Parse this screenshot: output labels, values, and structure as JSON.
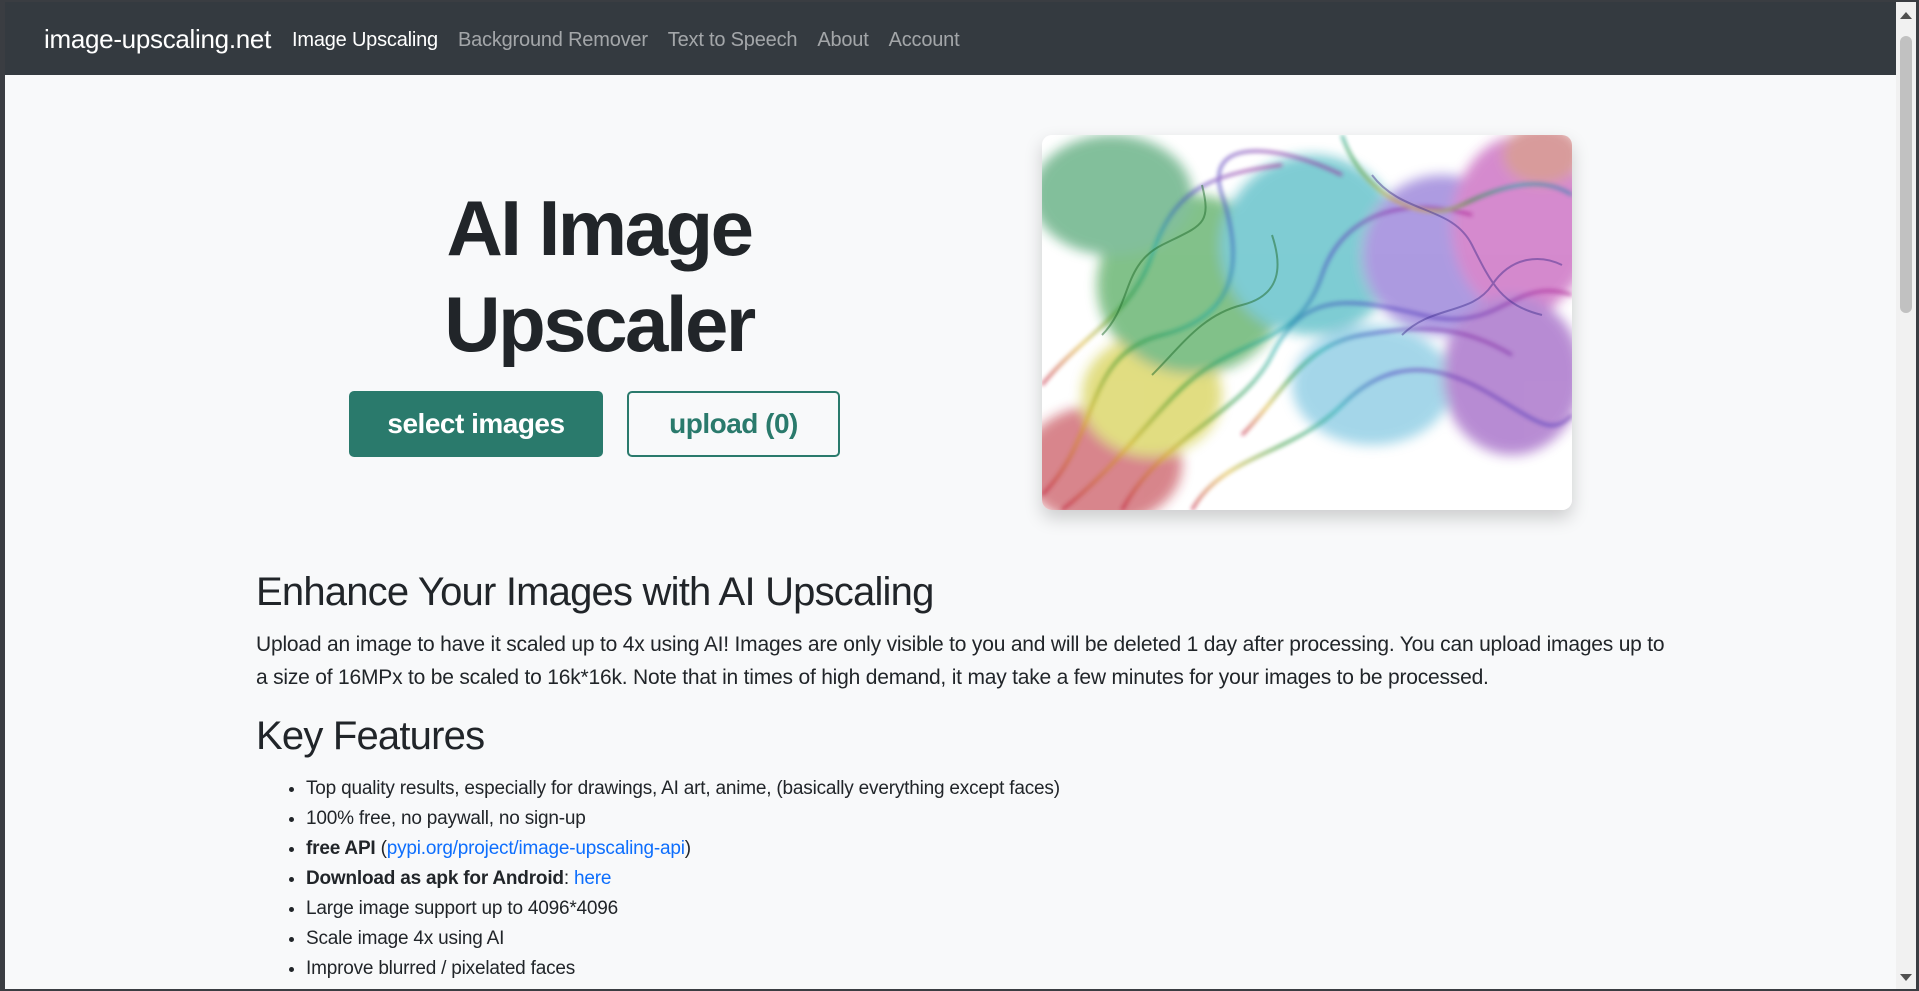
{
  "navbar": {
    "brand": "image-upscaling.net",
    "links": [
      "Image Upscaling",
      "Background Remover",
      "Text to Speech",
      "About",
      "Account"
    ]
  },
  "hero": {
    "title_line1": "AI Image",
    "title_line2": "Upscaler",
    "select_button": "select images",
    "upload_button": "upload (0)",
    "image": "rainbow-smoke-image"
  },
  "section1": {
    "heading": "Enhance Your Images with AI Upscaling",
    "paragraph": "Upload an image to have it scaled up to 4x using AI! Images are only visible to you and will be deleted 1 day after processing. You can upload images up to a size of 16MPx to be scaled to 16k*16k. Note that in times of high demand, it may take a few minutes for your images to be processed."
  },
  "section2": {
    "heading": "Key Features",
    "items": [
      "Top quality results, especially for drawings, AI art, anime, (basically everything except faces)",
      "100% free, no paywall, no sign-up",
      {
        "bold": "free API",
        "pre": " (",
        "link": "pypi.org/project/image-upscaling-api",
        "post": ")"
      },
      {
        "bold": "Download as apk for Android",
        "pre": ": ",
        "link": "here",
        "post": ""
      },
      "Large image support up to 4096*4096",
      "Scale image 4x using AI",
      "Improve blurred / pixelated faces"
    ]
  },
  "colors": {
    "accent": "#2a7a6c",
    "navbar": "#343a40",
    "link": "#0d6efd"
  }
}
